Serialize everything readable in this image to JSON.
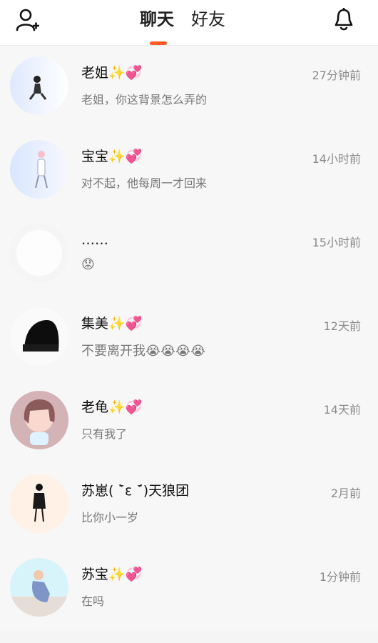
{
  "header": {
    "tabs": [
      "聊天",
      "好友"
    ]
  },
  "chats": [
    {
      "name": "老姐✨💞",
      "time": "27分钟前",
      "preview": " 老姐，你这背景怎么弄的"
    },
    {
      "name": "宝宝✨💞",
      "time": "14小时前",
      "preview": "对不起，他每周一才回来"
    },
    {
      "name": "……",
      "time": "15小时前",
      "preview": "😟"
    },
    {
      "name": "集美✨💞",
      "time": "12天前",
      "preview": "不要离开我😭😭😭😭"
    },
    {
      "name": "老龟✨💞",
      "time": "14天前",
      "preview": "只有我了"
    },
    {
      "name": "苏崽( ˉ̀ε ˉ́)天狼团",
      "time": "2月前",
      "preview": "比你小一岁"
    },
    {
      "name": "苏宝✨💞",
      "time": "1分钟前",
      "preview": "在吗"
    }
  ]
}
